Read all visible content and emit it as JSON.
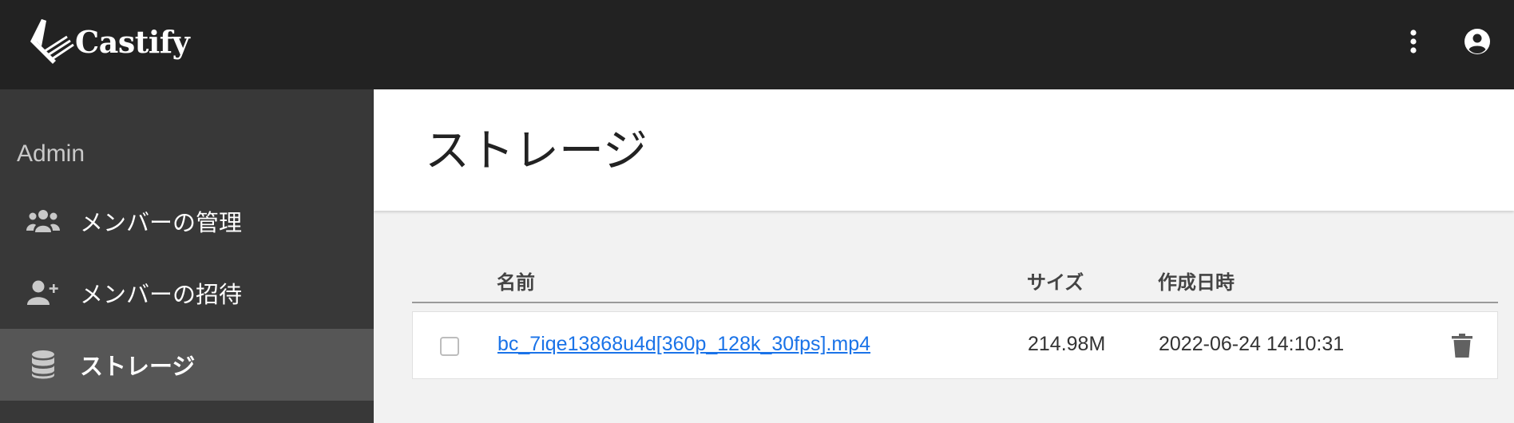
{
  "app": {
    "logo_text": "Castify",
    "logo_icon": "castify-logo-icon"
  },
  "topbar": {
    "more_icon": "more-vert-icon",
    "account_icon": "account-circle-icon"
  },
  "sidebar": {
    "heading": "Admin",
    "items": [
      {
        "label": "メンバーの管理",
        "icon": "group-icon",
        "active": false
      },
      {
        "label": "メンバーの招待",
        "icon": "person-add-icon",
        "active": false
      },
      {
        "label": "ストレージ",
        "icon": "database-icon",
        "active": true
      }
    ]
  },
  "main": {
    "title": "ストレージ",
    "table": {
      "headers": {
        "name": "名前",
        "size": "サイズ",
        "created": "作成日時"
      },
      "rows": [
        {
          "name": "bc_7iqe13868u4d[360p_128k_30fps].mp4",
          "size": "214.98M",
          "created": "2022-06-24 14:10:31",
          "checked": false,
          "delete_icon": "trash-icon"
        }
      ]
    }
  },
  "colors": {
    "topbar": "#222222",
    "sidebar": "#383838",
    "sidebar_active": "#565656",
    "link": "#1a73e8"
  }
}
